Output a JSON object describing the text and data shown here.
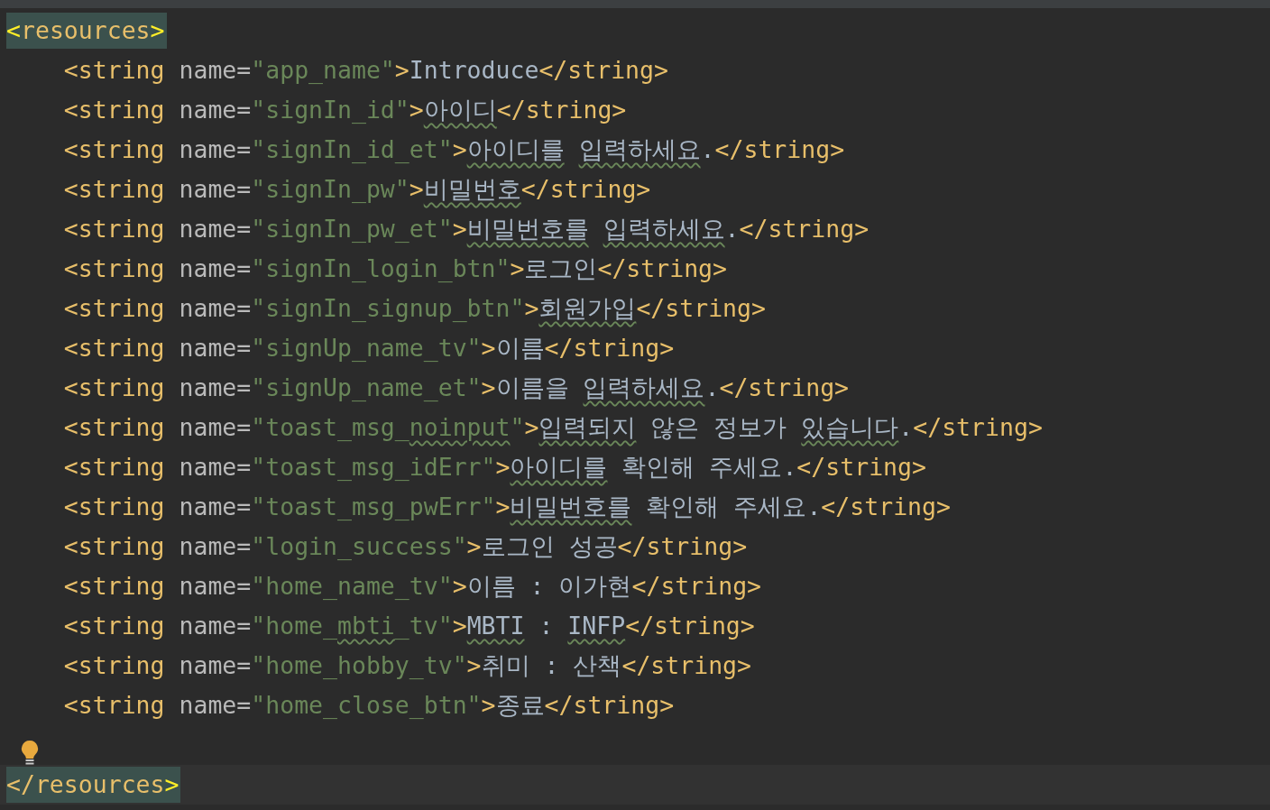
{
  "lines": [
    {
      "kind": "code",
      "highlighted": true,
      "tokens": [
        {
          "kind": "match",
          "text": "<",
          "typo": false
        },
        {
          "kind": "tag",
          "text": "resources",
          "typo": false
        },
        {
          "kind": "match",
          "text": ">",
          "typo": false
        }
      ]
    },
    {
      "kind": "code",
      "highlighted": false,
      "tokens": [
        {
          "kind": "tag",
          "text": "    <string",
          "typo": false
        },
        {
          "kind": "attr",
          "text": " name=",
          "typo": false
        },
        {
          "kind": "value",
          "text": "\"app_name\"",
          "typo": false
        },
        {
          "kind": "tag",
          "text": ">",
          "typo": false
        },
        {
          "kind": "text",
          "text": "Introduce",
          "typo": false
        },
        {
          "kind": "tag",
          "text": "</string>",
          "typo": false
        }
      ]
    },
    {
      "kind": "code",
      "highlighted": false,
      "tokens": [
        {
          "kind": "tag",
          "text": "    <string",
          "typo": false
        },
        {
          "kind": "attr",
          "text": " name=",
          "typo": false
        },
        {
          "kind": "value",
          "text": "\"signIn_id\"",
          "typo": false
        },
        {
          "kind": "tag",
          "text": ">",
          "typo": false
        },
        {
          "kind": "text",
          "text": "아이디",
          "typo": true
        },
        {
          "kind": "tag",
          "text": "</string>",
          "typo": false
        }
      ]
    },
    {
      "kind": "code",
      "highlighted": false,
      "tokens": [
        {
          "kind": "tag",
          "text": "    <string",
          "typo": false
        },
        {
          "kind": "attr",
          "text": " name=",
          "typo": false
        },
        {
          "kind": "value",
          "text": "\"signIn_id_et\"",
          "typo": false
        },
        {
          "kind": "tag",
          "text": ">",
          "typo": false
        },
        {
          "kind": "text",
          "text": "아이디를",
          "typo": true
        },
        {
          "kind": "text",
          "text": " 입력하세요",
          "typo": true
        },
        {
          "kind": "text",
          "text": ".",
          "typo": false
        },
        {
          "kind": "tag",
          "text": "</string>",
          "typo": false
        }
      ]
    },
    {
      "kind": "code",
      "highlighted": false,
      "tokens": [
        {
          "kind": "tag",
          "text": "    <string",
          "typo": false
        },
        {
          "kind": "attr",
          "text": " name=",
          "typo": false
        },
        {
          "kind": "value",
          "text": "\"signIn_pw\"",
          "typo": false
        },
        {
          "kind": "tag",
          "text": ">",
          "typo": false
        },
        {
          "kind": "text",
          "text": "비밀번호",
          "typo": true
        },
        {
          "kind": "tag",
          "text": "</string>",
          "typo": false
        }
      ]
    },
    {
      "kind": "code",
      "highlighted": false,
      "tokens": [
        {
          "kind": "tag",
          "text": "    <string",
          "typo": false
        },
        {
          "kind": "attr",
          "text": " name=",
          "typo": false
        },
        {
          "kind": "value",
          "text": "\"signIn_pw_et\"",
          "typo": false
        },
        {
          "kind": "tag",
          "text": ">",
          "typo": false
        },
        {
          "kind": "text",
          "text": "비밀번호를",
          "typo": true
        },
        {
          "kind": "text",
          "text": " 입력하세요",
          "typo": true
        },
        {
          "kind": "text",
          "text": ".",
          "typo": false
        },
        {
          "kind": "tag",
          "text": "</string>",
          "typo": false
        }
      ]
    },
    {
      "kind": "code",
      "highlighted": false,
      "tokens": [
        {
          "kind": "tag",
          "text": "    <string",
          "typo": false
        },
        {
          "kind": "attr",
          "text": " name=",
          "typo": false
        },
        {
          "kind": "value",
          "text": "\"signIn_login_btn\"",
          "typo": false
        },
        {
          "kind": "tag",
          "text": ">",
          "typo": false
        },
        {
          "kind": "text",
          "text": "로그인",
          "typo": false
        },
        {
          "kind": "tag",
          "text": "</string>",
          "typo": false
        }
      ]
    },
    {
      "kind": "code",
      "highlighted": false,
      "tokens": [
        {
          "kind": "tag",
          "text": "    <string",
          "typo": false
        },
        {
          "kind": "attr",
          "text": " name=",
          "typo": false
        },
        {
          "kind": "value",
          "text": "\"signIn_signup_btn\"",
          "typo": false
        },
        {
          "kind": "tag",
          "text": ">",
          "typo": false
        },
        {
          "kind": "text",
          "text": "회원가입",
          "typo": true
        },
        {
          "kind": "tag",
          "text": "</string>",
          "typo": false
        }
      ]
    },
    {
      "kind": "code",
      "highlighted": false,
      "tokens": [
        {
          "kind": "tag",
          "text": "    <string",
          "typo": false
        },
        {
          "kind": "attr",
          "text": " name=",
          "typo": false
        },
        {
          "kind": "value",
          "text": "\"signUp_name_tv\"",
          "typo": false
        },
        {
          "kind": "tag",
          "text": ">",
          "typo": false
        },
        {
          "kind": "text",
          "text": "이름",
          "typo": false
        },
        {
          "kind": "tag",
          "text": "</string>",
          "typo": false
        }
      ]
    },
    {
      "kind": "code",
      "highlighted": false,
      "tokens": [
        {
          "kind": "tag",
          "text": "    <string",
          "typo": false
        },
        {
          "kind": "attr",
          "text": " name=",
          "typo": false
        },
        {
          "kind": "value",
          "text": "\"signUp_name_et\"",
          "typo": false
        },
        {
          "kind": "tag",
          "text": ">",
          "typo": false
        },
        {
          "kind": "text",
          "text": "이름을 ",
          "typo": false
        },
        {
          "kind": "text",
          "text": "입력하세요",
          "typo": true
        },
        {
          "kind": "text",
          "text": ".",
          "typo": false
        },
        {
          "kind": "tag",
          "text": "</string>",
          "typo": false
        }
      ]
    },
    {
      "kind": "code",
      "highlighted": false,
      "tokens": [
        {
          "kind": "tag",
          "text": "    <string",
          "typo": false
        },
        {
          "kind": "attr",
          "text": " name=",
          "typo": false
        },
        {
          "kind": "value",
          "text": "\"toast_msg_",
          "typo": false
        },
        {
          "kind": "value",
          "text": "noinput",
          "typo": true
        },
        {
          "kind": "value",
          "text": "\"",
          "typo": false
        },
        {
          "kind": "tag",
          "text": ">",
          "typo": false
        },
        {
          "kind": "text",
          "text": "입력되지",
          "typo": true
        },
        {
          "kind": "text",
          "text": " 않은 정보가 ",
          "typo": false
        },
        {
          "kind": "text",
          "text": "있습니다",
          "typo": true
        },
        {
          "kind": "text",
          "text": ".",
          "typo": false
        },
        {
          "kind": "tag",
          "text": "</string>",
          "typo": false
        }
      ]
    },
    {
      "kind": "code",
      "highlighted": false,
      "tokens": [
        {
          "kind": "tag",
          "text": "    <string",
          "typo": false
        },
        {
          "kind": "attr",
          "text": " name=",
          "typo": false
        },
        {
          "kind": "value",
          "text": "\"toast_msg_idErr\"",
          "typo": false
        },
        {
          "kind": "tag",
          "text": ">",
          "typo": false
        },
        {
          "kind": "text",
          "text": "아이디를",
          "typo": true
        },
        {
          "kind": "text",
          "text": " 확인해 주세요.",
          "typo": false
        },
        {
          "kind": "tag",
          "text": "</string>",
          "typo": false
        }
      ]
    },
    {
      "kind": "code",
      "highlighted": false,
      "tokens": [
        {
          "kind": "tag",
          "text": "    <string",
          "typo": false
        },
        {
          "kind": "attr",
          "text": " name=",
          "typo": false
        },
        {
          "kind": "value",
          "text": "\"toast_msg_pwErr\"",
          "typo": false
        },
        {
          "kind": "tag",
          "text": ">",
          "typo": false
        },
        {
          "kind": "text",
          "text": "비밀번호를",
          "typo": true
        },
        {
          "kind": "text",
          "text": " 확인해 주세요.",
          "typo": false
        },
        {
          "kind": "tag",
          "text": "</string>",
          "typo": false
        }
      ]
    },
    {
      "kind": "code",
      "highlighted": false,
      "tokens": [
        {
          "kind": "tag",
          "text": "    <string",
          "typo": false
        },
        {
          "kind": "attr",
          "text": " name=",
          "typo": false
        },
        {
          "kind": "value",
          "text": "\"login_success\"",
          "typo": false
        },
        {
          "kind": "tag",
          "text": ">",
          "typo": false
        },
        {
          "kind": "text",
          "text": "로그인 성공",
          "typo": false
        },
        {
          "kind": "tag",
          "text": "</string>",
          "typo": false
        }
      ]
    },
    {
      "kind": "code",
      "highlighted": false,
      "tokens": [
        {
          "kind": "tag",
          "text": "    <string",
          "typo": false
        },
        {
          "kind": "attr",
          "text": " name=",
          "typo": false
        },
        {
          "kind": "value",
          "text": "\"home_name_tv\"",
          "typo": false
        },
        {
          "kind": "tag",
          "text": ">",
          "typo": false
        },
        {
          "kind": "text",
          "text": "이름 : 이가현",
          "typo": false
        },
        {
          "kind": "tag",
          "text": "</string>",
          "typo": false
        }
      ]
    },
    {
      "kind": "code",
      "highlighted": false,
      "tokens": [
        {
          "kind": "tag",
          "text": "    <string",
          "typo": false
        },
        {
          "kind": "attr",
          "text": " name=",
          "typo": false
        },
        {
          "kind": "value",
          "text": "\"home_",
          "typo": false
        },
        {
          "kind": "value",
          "text": "mbti",
          "typo": true
        },
        {
          "kind": "value",
          "text": "_tv\"",
          "typo": false
        },
        {
          "kind": "tag",
          "text": ">",
          "typo": false
        },
        {
          "kind": "text",
          "text": "MBTI",
          "typo": true
        },
        {
          "kind": "text",
          "text": " : ",
          "typo": false
        },
        {
          "kind": "text",
          "text": "INFP",
          "typo": true
        },
        {
          "kind": "tag",
          "text": "</string>",
          "typo": false
        }
      ]
    },
    {
      "kind": "code",
      "highlighted": false,
      "tokens": [
        {
          "kind": "tag",
          "text": "    <string",
          "typo": false
        },
        {
          "kind": "attr",
          "text": " name=",
          "typo": false
        },
        {
          "kind": "value",
          "text": "\"home_hobby_tv\"",
          "typo": false
        },
        {
          "kind": "tag",
          "text": ">",
          "typo": false
        },
        {
          "kind": "text",
          "text": "취미 : 산책",
          "typo": false
        },
        {
          "kind": "tag",
          "text": "</string>",
          "typo": false
        }
      ]
    },
    {
      "kind": "code",
      "highlighted": false,
      "tokens": [
        {
          "kind": "tag",
          "text": "    <string",
          "typo": false
        },
        {
          "kind": "attr",
          "text": " name=",
          "typo": false
        },
        {
          "kind": "value",
          "text": "\"home_close_btn\"",
          "typo": false
        },
        {
          "kind": "tag",
          "text": ">",
          "typo": false
        },
        {
          "kind": "text",
          "text": "종료",
          "typo": false
        },
        {
          "kind": "tag",
          "text": "</string>",
          "typo": false
        }
      ]
    },
    {
      "kind": "bulb"
    },
    {
      "kind": "current-line",
      "highlighted": true,
      "tokens": [
        {
          "kind": "tag",
          "text": "</resources",
          "typo": false
        },
        {
          "kind": "match",
          "text": ">",
          "typo": false
        }
      ]
    }
  ]
}
